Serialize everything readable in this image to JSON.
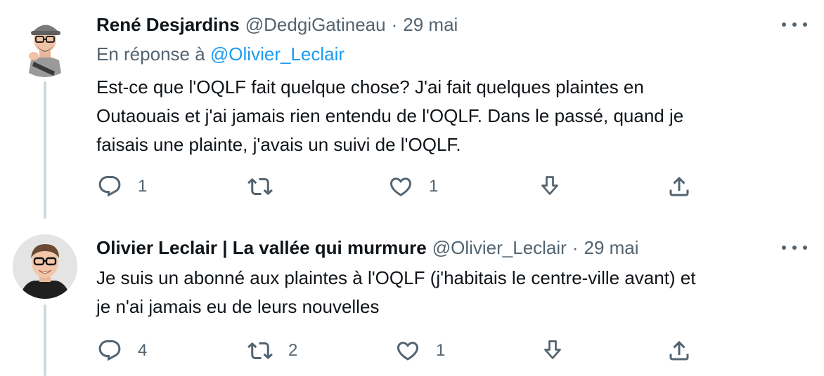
{
  "tweets": [
    {
      "name": "René Desjardins",
      "handle": "@DedgiGatineau",
      "separator": "·",
      "time": "29 mai",
      "reply_prefix": "En réponse à",
      "reply_mention": "@Olivier_Leclair",
      "text": "Est-ce que l'OQLF fait quelque chose? J'ai fait quelques plaintes en\nOutaouais et j'ai jamais rien entendu de l'OQLF.  Dans le passé, quand je\nfaisais une plainte, j'avais un suivi de l'OQLF.",
      "replies": "1",
      "retweets": "",
      "likes": "1"
    },
    {
      "name": "Olivier Leclair | La vallée qui murmure",
      "handle": "@Olivier_Leclair",
      "separator": "·",
      "time": "29 mai",
      "text": "Je suis un abonné aux plaintes à l'OQLF (j'habitais le centre-ville avant) et\nje n'ai jamais eu de leurs nouvelles",
      "replies": "4",
      "retweets": "2",
      "likes": "1"
    }
  ],
  "icons": {
    "reply": "reply-icon",
    "retweet": "retweet-icon",
    "like": "heart-icon",
    "download": "download-icon",
    "share": "share-icon",
    "more": "more-icon"
  },
  "colors": {
    "text": "#0f1419",
    "secondary": "#536471",
    "link": "#1d9bf0",
    "thread_line": "#cfd9de"
  }
}
